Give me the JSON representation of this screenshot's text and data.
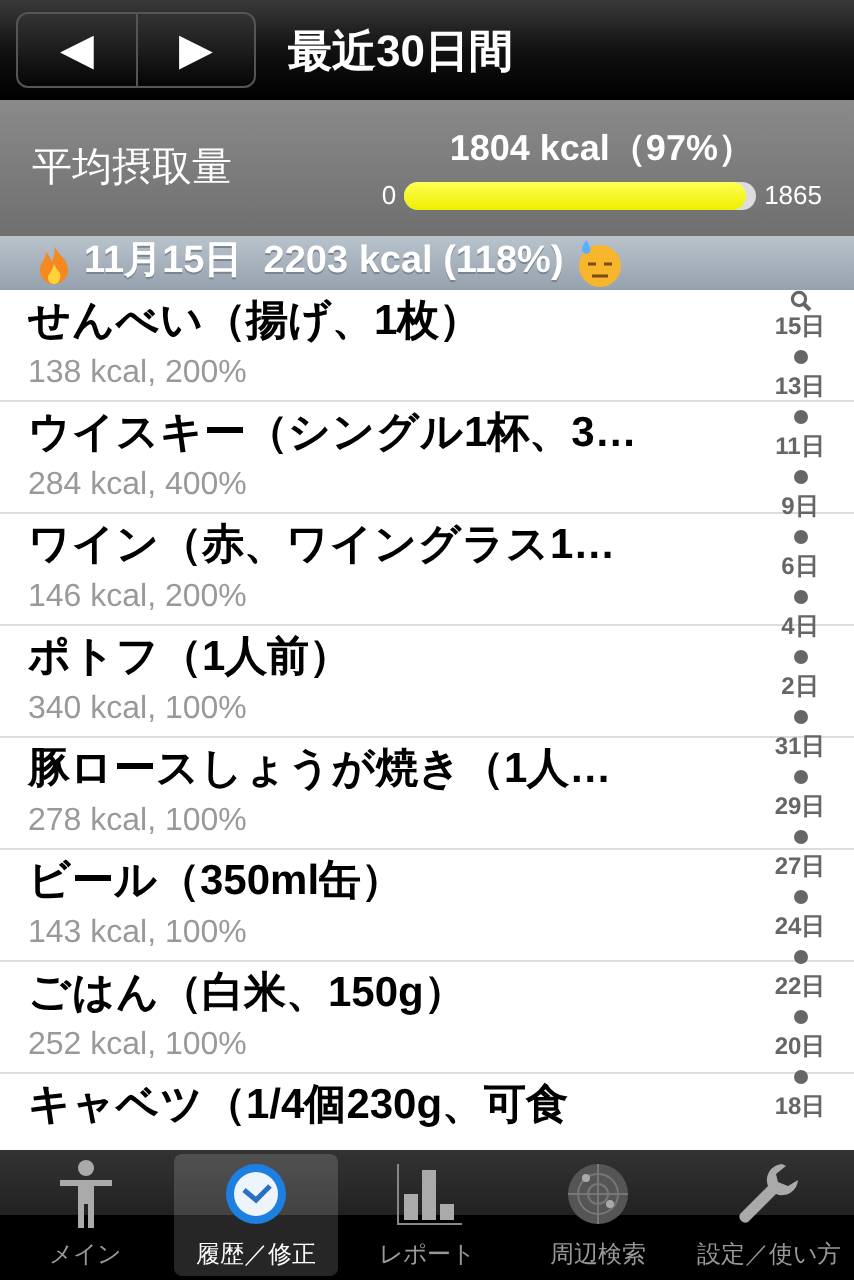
{
  "nav": {
    "prev": "◀",
    "next": "▶",
    "title": "最近30日間"
  },
  "summary": {
    "label": "平均摂取量",
    "value": "1804 kcal（97%）",
    "min": "0",
    "max": "1865",
    "level": 0.97
  },
  "section": {
    "title": "11月15日  2203 kcal (118%)"
  },
  "entries": [
    {
      "name": "せんべい（揚げ、1枚）",
      "detail": "138 kcal, 200%"
    },
    {
      "name": "ウイスキー（シングル1杯、3…",
      "detail": "284 kcal, 400%"
    },
    {
      "name": "ワイン（赤、ワイングラス1…",
      "detail": "146 kcal, 200%"
    },
    {
      "name": "ポトフ（1人前）",
      "detail": "340 kcal, 100%"
    },
    {
      "name": "豚ロースしょうが焼き（1人…",
      "detail": "278 kcal, 100%"
    },
    {
      "name": "ビール（350ml缶）",
      "detail": "143 kcal, 100%"
    },
    {
      "name": "ごはん（白米、150g）",
      "detail": "252 kcal, 100%"
    },
    {
      "name": "キャベツ（1/4個230g、可食"
    }
  ],
  "index": [
    "15日",
    "13日",
    "11日",
    "9日",
    "6日",
    "4日",
    "2日",
    "31日",
    "29日",
    "27日",
    "24日",
    "22日",
    "20日",
    "18日"
  ],
  "tabs": [
    {
      "label": "メイン",
      "kind": "person",
      "selected": false
    },
    {
      "label": "履歴／修正",
      "kind": "clock",
      "selected": true
    },
    {
      "label": "レポート",
      "kind": "chart",
      "selected": false
    },
    {
      "label": "周辺検索",
      "kind": "radar",
      "selected": false
    },
    {
      "label": "設定／使い方",
      "kind": "wrench",
      "selected": false
    }
  ]
}
